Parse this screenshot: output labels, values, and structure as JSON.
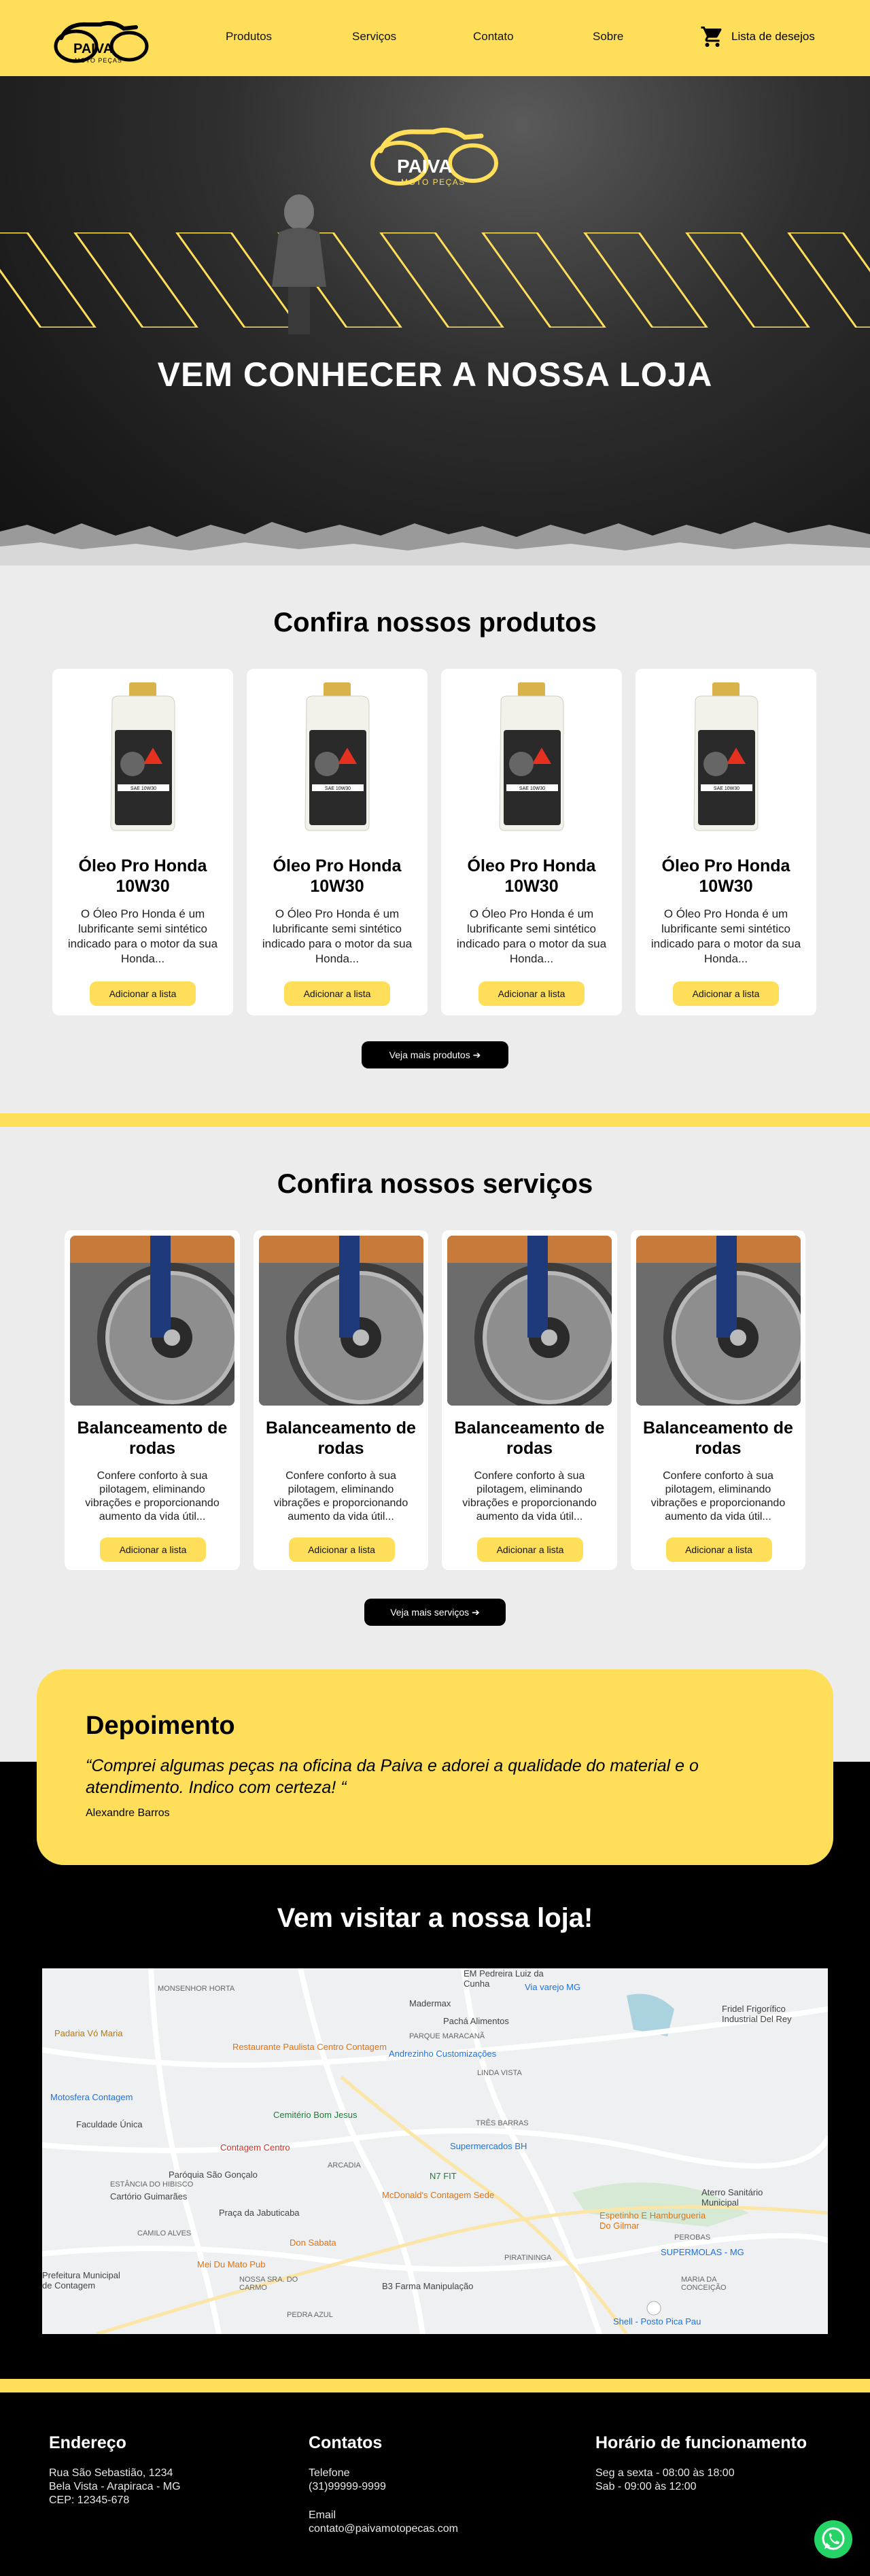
{
  "header": {
    "logo_name": "PAIVA",
    "logo_sub": "MOTO PEÇAS",
    "nav": [
      "Produtos",
      "Serviços",
      "Contato",
      "Sobre"
    ],
    "wishlist": "Lista de desejos"
  },
  "hero": {
    "logo_name": "PAIVA",
    "logo_sub": "MOTO PEÇAS",
    "title": "VEM CONHECER A NOSSA LOJA"
  },
  "products": {
    "title": "Confira nossos produtos",
    "items": [
      {
        "name": "Óleo Pro Honda 10W30",
        "desc": "O Óleo Pro Honda é um lubrificante semi sintético indicado para o motor da sua Honda...",
        "button": "Adicionar a lista"
      },
      {
        "name": "Óleo Pro Honda 10W30",
        "desc": "O Óleo Pro Honda é um lubrificante semi sintético indicado para o motor da sua Honda...",
        "button": "Adicionar a lista"
      },
      {
        "name": "Óleo Pro Honda 10W30",
        "desc": "O Óleo Pro Honda é um lubrificante semi sintético indicado para o motor da sua Honda...",
        "button": "Adicionar a lista"
      },
      {
        "name": "Óleo Pro Honda 10W30",
        "desc": "O Óleo Pro Honda é um lubrificante semi sintético indicado para o motor da sua Honda...",
        "button": "Adicionar a lista"
      }
    ],
    "more": "Veja mais produtos ➔",
    "bottle_label": "SAE 10W30"
  },
  "services": {
    "title": "Confira nossos serviços",
    "items": [
      {
        "name": "Balanceamento de rodas",
        "desc": "Confere conforto à sua pilotagem, eliminando vibrações e proporcionando aumento da vida útil...",
        "button": "Adicionar a lista"
      },
      {
        "name": "Balanceamento de rodas",
        "desc": "Confere conforto à sua pilotagem, eliminando vibrações e proporcionando aumento da vida útil...",
        "button": "Adicionar a lista"
      },
      {
        "name": "Balanceamento de rodas",
        "desc": "Confere conforto à sua pilotagem, eliminando vibrações e proporcionando aumento da vida útil...",
        "button": "Adicionar a lista"
      },
      {
        "name": "Balanceamento de rodas",
        "desc": "Confere conforto à sua pilotagem, eliminando vibrações e proporcionando aumento da vida útil...",
        "button": "Adicionar a lista"
      }
    ],
    "more": "Veja mais serviços ➔"
  },
  "testimonial": {
    "title": "Depoimento",
    "quote": "“Comprei algumas peças na oficina da Paiva e adorei a qualidade do material e o atendimento. Indico com certeza! “",
    "author": "Alexandre Barros"
  },
  "visit": {
    "title": "Vem visitar a nossa loja!",
    "map_labels": {
      "padaria": "Padaria Vó Maria",
      "restaurante": "Restaurante Paulista Centro Contagem",
      "andrezinho": "Andrezinho Customizações",
      "cemiterio": "Cemitério Bom Jesus",
      "motosfera": "Motosfera Contagem",
      "faculdade": "Faculdade Única",
      "contagem_centro": "Contagem Centro",
      "supermercados": "Supermercados BH",
      "paroquia": "Paróquia São Gonçalo",
      "cartorio": "Cartório Guimarães",
      "mcdonalds": "McDonald's Contagem Sede",
      "n7fit": "N7 FIT",
      "praca": "Praça da Jabuticaba",
      "don_sabata": "Don Sabata",
      "mei_mato": "Mei Du Mato Pub",
      "b3": "B3 Farma Manipulação",
      "prefeitura": "Prefeitura Municipal de Contagem",
      "espetinho": "Espetinho E Hamburgueria Do Gilmar",
      "via_varejo": "Via varejo MG",
      "madermax": "Madermax",
      "pacha": "Pachá Alimentos",
      "frigorifico": "Fridel Frigorífico Industrial Del Rey",
      "aterro": "Aterro Sanitário Municipal",
      "supermolas": "SUPERMOLAS - MG",
      "shell": "Shell - Posto Pica Pau",
      "monsenhor": "MONSENHOR HORTA",
      "linda_vista": "LINDA VISTA",
      "tres_barras": "TRÊS BARRAS",
      "arcadia": "ARCADIA",
      "estancia": "ESTÂNCIA DO HIBISCO",
      "camilo": "CAMILO ALVES",
      "nossa_senhora": "NOSSA SRA. DO CARMO",
      "pedra_azul": "PEDRA AZUL",
      "perobas": "PEROBAS",
      "maria_conceicao": "MARIA DA CONCEIÇÃO",
      "piratininga": "PIRATININGA",
      "parque_maracana": "PARQUE MARACANÃ",
      "em_pedreira": "EM Pedreira Luiz da Cunha"
    }
  },
  "footer": {
    "address": {
      "title": "Endereço",
      "lines": [
        "Rua São Sebastião, 1234",
        "Bela Vista - Arapiraca - MG",
        "CEP: 12345-678"
      ]
    },
    "contacts": {
      "title": "Contatos",
      "phone_label": "Telefone",
      "phone": "(31)99999-9999",
      "email_label": "Email",
      "email": "contato@paivamotopecas.com"
    },
    "hours": {
      "title": "Horário de funcionamento",
      "lines": [
        "Seg a sexta - 08:00 às 18:00",
        "Sab - 09:00 às 12:00"
      ]
    }
  },
  "colors": {
    "accent": "#ffde59",
    "dark": "#000000",
    "whatsapp": "#25d366"
  }
}
